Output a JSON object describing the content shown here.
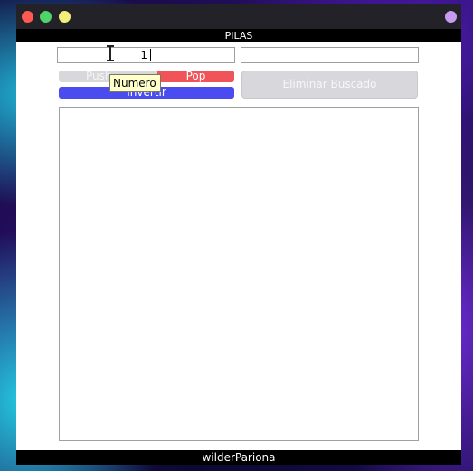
{
  "window": {
    "title": "PILAS",
    "footer": "wilderPariona",
    "controls": [
      "close-icon",
      "maximize-icon",
      "minimize-icon",
      "window-menu-icon"
    ]
  },
  "inputs": {
    "numero": {
      "value": "1",
      "tooltip": "Numero"
    },
    "buscar": {
      "value": ""
    }
  },
  "buttons": {
    "push": "Push",
    "pop": "Pop",
    "invert": "Invertir",
    "delete": "Eliminar Buscado"
  },
  "list": {
    "items": []
  },
  "colors": {
    "pop": "#f05459",
    "invert": "#4a4cf0",
    "disabled": "#d8d8dc",
    "bar": "#000000"
  }
}
